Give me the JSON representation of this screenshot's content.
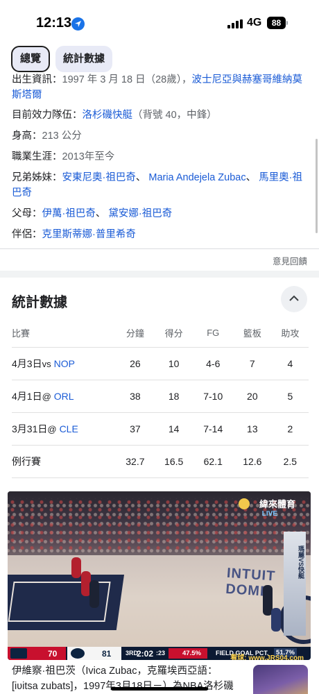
{
  "status": {
    "time": "12:13",
    "network": "4G",
    "battery": "88"
  },
  "chips": [
    {
      "label": "總覽"
    },
    {
      "label": "統計數據"
    }
  ],
  "info": {
    "born": {
      "key": "出生資訊",
      "value": "1997 年 3 月 18 日（28歲），",
      "link": "波士尼亞與赫塞哥維納莫斯塔爾"
    },
    "team": {
      "key": "目前效力隊伍",
      "link": "洛杉磯快艇",
      "suffix": "（背號 40，中鋒）"
    },
    "height": {
      "key": "身高",
      "value": "213 公分"
    },
    "career": {
      "key": "職業生涯",
      "value": "2013年至今"
    },
    "siblings": {
      "key": "兄弟姊妹",
      "links": [
        "安東尼奧·祖巴奇",
        "Maria Andejela Zubac",
        "馬里奧·祖巴奇"
      ]
    },
    "parents": {
      "key": "父母",
      "links": [
        "伊萬·祖巴奇",
        "黛安娜·祖巴奇"
      ]
    },
    "partner": {
      "key": "伴侶",
      "link": "克里斯蒂娜·普里希奇"
    }
  },
  "feedback": "意見回饋",
  "stats": {
    "title": "統計數據",
    "headers": [
      "比賽",
      "分鐘",
      "得分",
      "FG",
      "籃板",
      "助攻"
    ],
    "rows": [
      {
        "date": "4月3日",
        "vs": "vs",
        "team": "NOP",
        "min": "26",
        "pts": "10",
        "fg": "4-6",
        "reb": "7",
        "ast": "4"
      },
      {
        "date": "4月1日",
        "vs": "@",
        "team": "ORL",
        "min": "38",
        "pts": "18",
        "fg": "7-10",
        "reb": "20",
        "ast": "5"
      },
      {
        "date": "3月31日",
        "vs": "@",
        "team": "CLE",
        "min": "37",
        "pts": "14",
        "fg": "7-14",
        "reb": "13",
        "ast": "2"
      }
    ],
    "season": {
      "label": "例行賽",
      "min": "32.7",
      "pts": "16.5",
      "fg": "62.1",
      "reb": "12.6",
      "ast": "2.5"
    }
  },
  "video": {
    "channel": "緯來體育",
    "live": "LIVE",
    "court_text": "INTUIT DOME",
    "board_text": "瑪麗VS快艇",
    "score": {
      "team1": "70",
      "team2": "81",
      "quarter": "3RD",
      "clock": "2:02",
      "shot": ":23",
      "pct1": "47.5%",
      "fg_label": "FIELD GOAL PCT.",
      "pct2": "51.7%"
    },
    "watermark": "看球: www.JRS04.com"
  },
  "article": {
    "text": "伊維察·祖巴茨（Ivica Zubac，克羅埃西亞語：[iʋitsa zubats]，1997年3月18日－）為NBA洛杉磯"
  },
  "colors": {
    "link": "#1a5bd6",
    "chip_bg": "#e8eaf6",
    "team_red": "#c8102e",
    "team_navy": "#0c2340"
  }
}
